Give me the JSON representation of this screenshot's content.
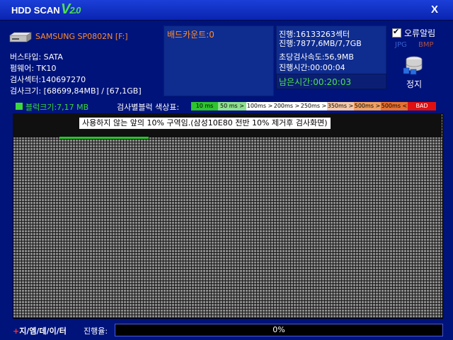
{
  "app": {
    "title": "HDD SCAN",
    "version_v": "V",
    "version_num": "2.0",
    "close_label": "X"
  },
  "drive": {
    "name": "SAMSUNG SP0802N [F:]",
    "bus_type": "버스타입: SATA",
    "firmware": "펌웨어: TK10",
    "sectors": "검사섹터:140697270",
    "size": "검사크기: [68699,84MB] / [67,1GB]"
  },
  "status": {
    "bad_count": "배드카운트:0",
    "progress_sector": "진행:16133263섹터",
    "progress_mb": "진행:7877,6MB/7,7GB",
    "speed": "초당검사속도:56,9MB",
    "elapsed": "진행시간:00:00:04",
    "remaining": "남은시간:00:20:03"
  },
  "options": {
    "error_alarm_label": "오류알림",
    "error_alarm_checked": true,
    "jpg_label": "JPG",
    "bmp_label": "BMP",
    "stop_label": "정지"
  },
  "legend": {
    "block_size": "블럭크기:7,17 MB",
    "title": "검사별블럭 색상표:",
    "items": [
      {
        "label": "10 ms",
        "color": "#2ec42e"
      },
      {
        "label": "50 ms >",
        "color": "#8ee08e"
      },
      {
        "label": "100ms >",
        "color": "#ffffff"
      },
      {
        "label": "200ms >",
        "color": "#ffffff"
      },
      {
        "label": "250ms >",
        "color": "#ffffff"
      },
      {
        "label": "350ms >",
        "color": "#f5c8a8"
      },
      {
        "label": "500ms >",
        "color": "#f0a060"
      },
      {
        "label": "500ms <",
        "color": "#e87030"
      },
      {
        "label": "BAD",
        "color": "#e01010"
      }
    ]
  },
  "scan": {
    "banner": "사용하지 않는 앞의 10% 구역임.(삼성10E80 전반 10% 제거후 검사화면)"
  },
  "footer": {
    "company": "+지/엠/데/이/터",
    "progress_label": "진행율:",
    "progress_text": "0%",
    "progress_value": 0
  }
}
